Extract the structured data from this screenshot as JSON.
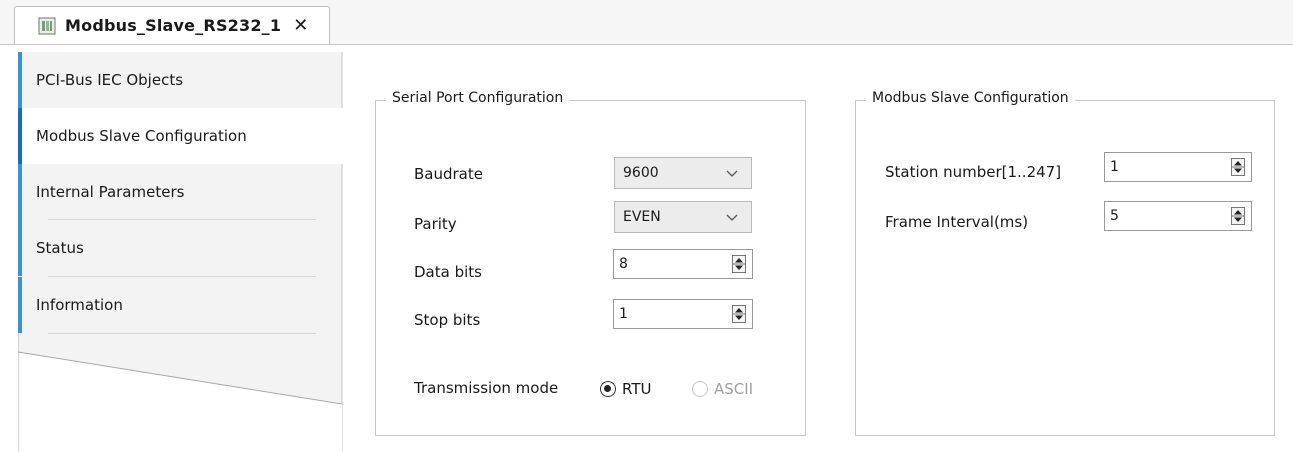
{
  "document_tab": {
    "title": "Modbus_Slave_RS232_1",
    "close_glyph": "✕",
    "icon": "device-icon"
  },
  "sidebar": {
    "items": [
      {
        "label": "PCI-Bus IEC Objects",
        "active": false
      },
      {
        "label": "Modbus Slave Configuration",
        "active": true
      },
      {
        "label": "Internal Parameters",
        "active": false
      },
      {
        "label": "Status",
        "active": false
      },
      {
        "label": "Information",
        "active": false
      }
    ]
  },
  "serial_port": {
    "title": "Serial Port Configuration",
    "baudrate": {
      "label": "Baudrate",
      "value": "9600"
    },
    "parity": {
      "label": "Parity",
      "value": "EVEN"
    },
    "data_bits": {
      "label": "Data bits",
      "value": "8"
    },
    "stop_bits": {
      "label": "Stop bits",
      "value": "1"
    },
    "transmission_mode": {
      "label": "Transmission mode",
      "options": [
        {
          "label": "RTU",
          "selected": true,
          "enabled": true
        },
        {
          "label": "ASCII",
          "selected": false,
          "enabled": false
        }
      ]
    }
  },
  "modbus_slave": {
    "title": "Modbus Slave Configuration",
    "station_number": {
      "label": "Station number[1..247]",
      "value": "1"
    },
    "frame_interval": {
      "label": "Frame Interval(ms)",
      "value": "5"
    }
  },
  "colors": {
    "accent_bar": "#3d8fd9",
    "active_bar": "#1d6ab8"
  }
}
